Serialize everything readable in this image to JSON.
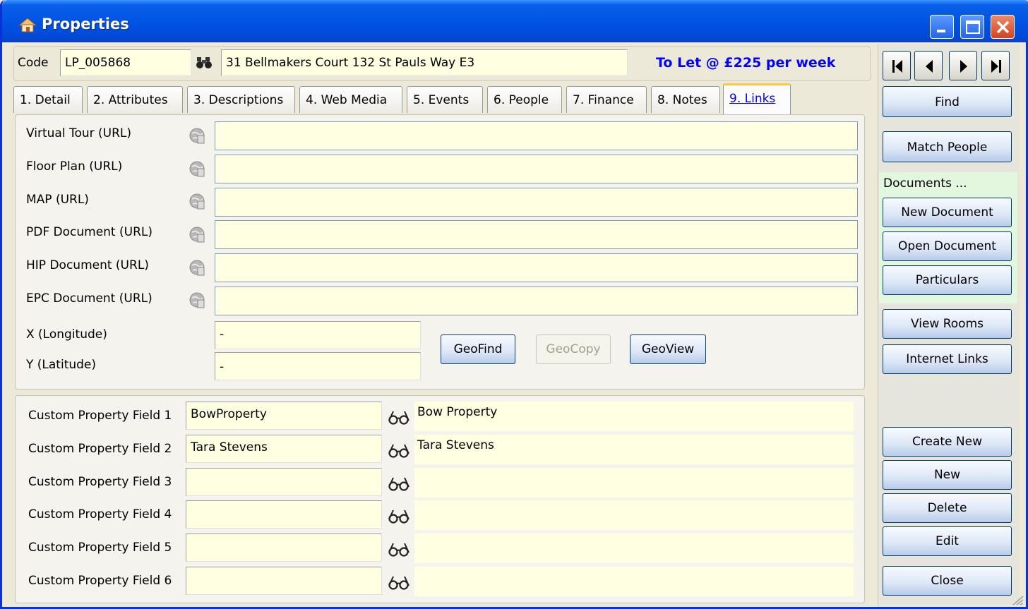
{
  "window": {
    "title": "Properties"
  },
  "header": {
    "code_label": "Code",
    "code_value": "LP_005868",
    "address": "31 Bellmakers Court 132 St Pauls Way E3",
    "status_text": "To Let @ £225 per week"
  },
  "tabs": [
    {
      "label": "1. Detail"
    },
    {
      "label": "2. Attributes"
    },
    {
      "label": "3. Descriptions"
    },
    {
      "label": "4. Web Media"
    },
    {
      "label": "5. Events"
    },
    {
      "label": "6. People"
    },
    {
      "label": "7. Finance"
    },
    {
      "label": "8. Notes"
    },
    {
      "label": "9. Links",
      "active": true
    }
  ],
  "links": [
    {
      "label": "Virtual Tour (URL)",
      "value": ""
    },
    {
      "label": "Floor Plan (URL)",
      "value": ""
    },
    {
      "label": "MAP (URL)",
      "value": ""
    },
    {
      "label": "PDF Document (URL)",
      "value": ""
    },
    {
      "label": "HIP Document (URL)",
      "value": ""
    },
    {
      "label": "EPC Document (URL)",
      "value": ""
    }
  ],
  "geo": {
    "x_label": "X (Longitude)",
    "x_value": "-",
    "y_label": "Y (Latitude)",
    "y_value": "-",
    "geofind": "GeoFind",
    "geocopy": "GeoCopy",
    "geoview": "GeoView"
  },
  "custom_fields": [
    {
      "label": "Custom Property Field 1",
      "value": "BowProperty",
      "display": "Bow Property"
    },
    {
      "label": "Custom Property Field 2",
      "value": "Tara Stevens",
      "display": "Tara Stevens"
    },
    {
      "label": "Custom Property Field 3",
      "value": "",
      "display": ""
    },
    {
      "label": "Custom Property Field 4",
      "value": "",
      "display": ""
    },
    {
      "label": "Custom Property Field 5",
      "value": "",
      "display": ""
    },
    {
      "label": "Custom Property Field 6",
      "value": "",
      "display": ""
    }
  ],
  "sidebar": {
    "find": "Find",
    "match_people": "Match People",
    "documents_label": "Documents ...",
    "new_document": "New Document",
    "open_document": "Open Document",
    "particulars": "Particulars",
    "view_rooms": "View Rooms",
    "internet_links": "Internet Links",
    "create_new": "Create New",
    "new": "New",
    "delete": "Delete",
    "edit": "Edit",
    "close": "Close"
  },
  "colors": {
    "field_bg": "#ffffe1",
    "status": "#0000ff",
    "titlebar": "#0054e3",
    "documents_bg": "#e3f7df"
  }
}
